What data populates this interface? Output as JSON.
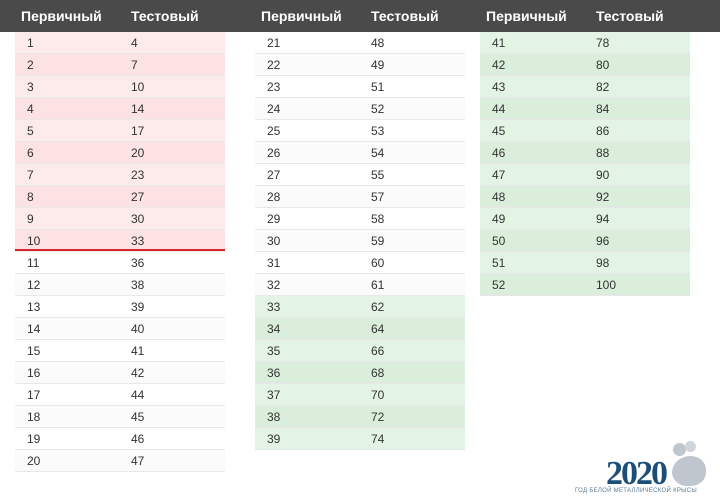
{
  "headers": {
    "primary": "Первичный",
    "test": "Тестовый"
  },
  "chart_data": {
    "type": "table",
    "title": "Score Conversion Table",
    "columns": [
      {
        "header_primary": "Первичный",
        "header_test": "Тестовый",
        "rows": [
          {
            "primary": 1,
            "test": 4,
            "band": "fail"
          },
          {
            "primary": 2,
            "test": 7,
            "band": "fail"
          },
          {
            "primary": 3,
            "test": 10,
            "band": "fail"
          },
          {
            "primary": 4,
            "test": 14,
            "band": "fail"
          },
          {
            "primary": 5,
            "test": 17,
            "band": "fail"
          },
          {
            "primary": 6,
            "test": 20,
            "band": "fail"
          },
          {
            "primary": 7,
            "test": 23,
            "band": "fail"
          },
          {
            "primary": 8,
            "test": 27,
            "band": "fail"
          },
          {
            "primary": 9,
            "test": 30,
            "band": "fail"
          },
          {
            "primary": 10,
            "test": 33,
            "band": "fail-threshold"
          },
          {
            "primary": 11,
            "test": 36,
            "band": "pass"
          },
          {
            "primary": 12,
            "test": 38,
            "band": "pass"
          },
          {
            "primary": 13,
            "test": 39,
            "band": "pass"
          },
          {
            "primary": 14,
            "test": 40,
            "band": "pass"
          },
          {
            "primary": 15,
            "test": 41,
            "band": "pass"
          },
          {
            "primary": 16,
            "test": 42,
            "band": "pass"
          },
          {
            "primary": 17,
            "test": 44,
            "band": "pass"
          },
          {
            "primary": 18,
            "test": 45,
            "band": "pass"
          },
          {
            "primary": 19,
            "test": 46,
            "band": "pass"
          },
          {
            "primary": 20,
            "test": 47,
            "band": "pass"
          }
        ]
      },
      {
        "header_primary": "Первичный",
        "header_test": "Тестовый",
        "rows": [
          {
            "primary": 21,
            "test": 48,
            "band": "pass"
          },
          {
            "primary": 22,
            "test": 49,
            "band": "pass"
          },
          {
            "primary": 23,
            "test": 51,
            "band": "pass"
          },
          {
            "primary": 24,
            "test": 52,
            "band": "pass"
          },
          {
            "primary": 25,
            "test": 53,
            "band": "pass"
          },
          {
            "primary": 26,
            "test": 54,
            "band": "pass"
          },
          {
            "primary": 27,
            "test": 55,
            "band": "pass"
          },
          {
            "primary": 28,
            "test": 57,
            "band": "pass"
          },
          {
            "primary": 29,
            "test": 58,
            "band": "pass"
          },
          {
            "primary": 30,
            "test": 59,
            "band": "pass"
          },
          {
            "primary": 31,
            "test": 60,
            "band": "pass"
          },
          {
            "primary": 32,
            "test": 61,
            "band": "pass"
          },
          {
            "primary": 33,
            "test": 62,
            "band": "high"
          },
          {
            "primary": 34,
            "test": 64,
            "band": "high"
          },
          {
            "primary": 35,
            "test": 66,
            "band": "high"
          },
          {
            "primary": 36,
            "test": 68,
            "band": "high"
          },
          {
            "primary": 37,
            "test": 70,
            "band": "high"
          },
          {
            "primary": 38,
            "test": 72,
            "band": "high"
          },
          {
            "primary": 39,
            "test": 74,
            "band": "high"
          }
        ]
      },
      {
        "header_primary": "Первичный",
        "header_test": "Тестовый",
        "rows": [
          {
            "primary": 41,
            "test": 78,
            "band": "high"
          },
          {
            "primary": 42,
            "test": 80,
            "band": "high"
          },
          {
            "primary": 43,
            "test": 82,
            "band": "high"
          },
          {
            "primary": 44,
            "test": 84,
            "band": "high"
          },
          {
            "primary": 45,
            "test": 86,
            "band": "high"
          },
          {
            "primary": 46,
            "test": 88,
            "band": "high"
          },
          {
            "primary": 47,
            "test": 90,
            "band": "high"
          },
          {
            "primary": 48,
            "test": 92,
            "band": "high"
          },
          {
            "primary": 49,
            "test": 94,
            "band": "high"
          },
          {
            "primary": 50,
            "test": 96,
            "band": "high"
          },
          {
            "primary": 51,
            "test": 98,
            "band": "high"
          },
          {
            "primary": 52,
            "test": 100,
            "band": "high"
          }
        ]
      }
    ]
  },
  "watermark": {
    "year": "2020",
    "subtitle": "ГОД БЕЛОЙ МЕТАЛЛИЧЕСКОЙ КРЫСЫ"
  }
}
